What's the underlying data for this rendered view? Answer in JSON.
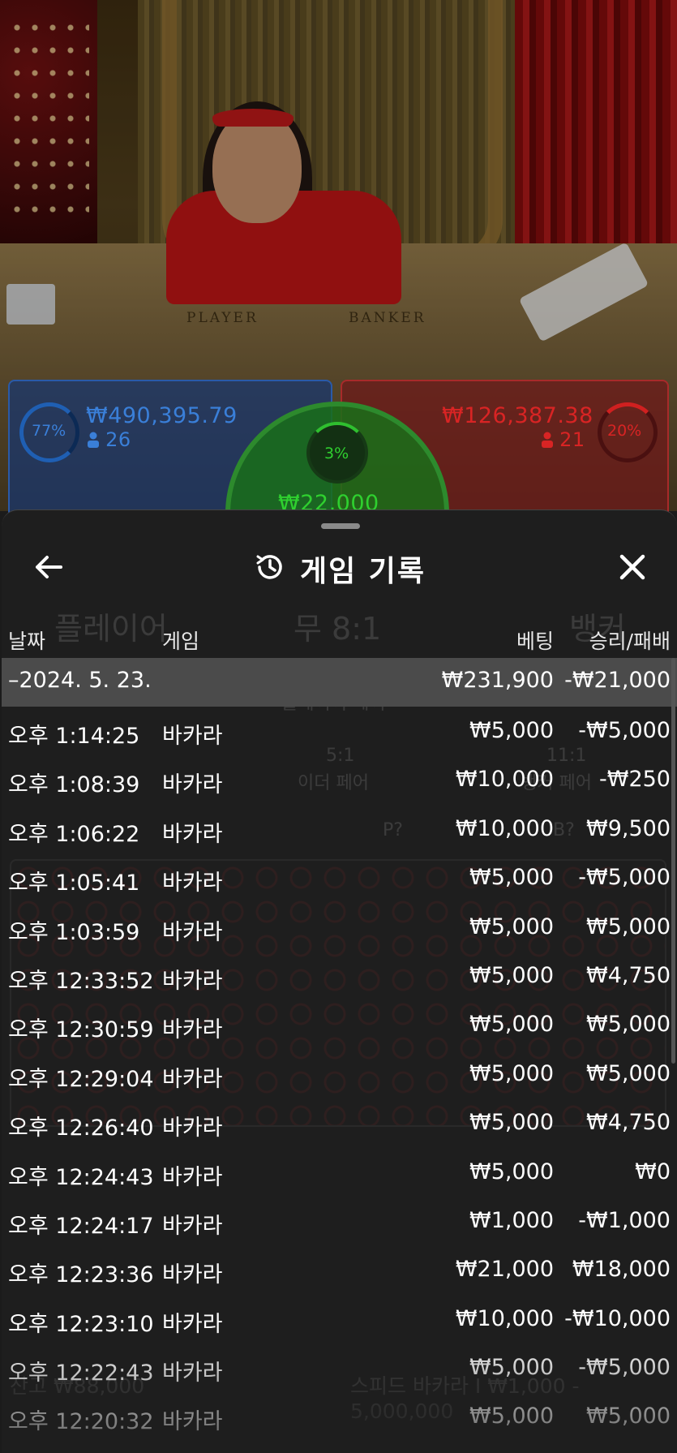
{
  "live_table": {
    "table_labels": {
      "player": "PLAYER",
      "banker": "BANKER"
    },
    "player": {
      "percent": "77%",
      "amount": "₩490,395.79",
      "players": "26",
      "color": "#3a7fd8"
    },
    "banker": {
      "percent": "20%",
      "amount": "₩126,387.38",
      "players": "21",
      "color": "#d82424"
    },
    "tie": {
      "percent": "3%",
      "amount": "₩22,000",
      "color": "#2fd02f"
    }
  },
  "sheet": {
    "title": "게임 기록",
    "icons": {
      "back": "arrow-left-icon",
      "history": "history-clock-icon",
      "close": "close-icon"
    },
    "columns": {
      "date": "날짜",
      "game": "게임",
      "bet": "베팅",
      "result": "승리/패배"
    },
    "date_group": {
      "date": "–2024. 5. 23.",
      "bet_total": "₩231,900",
      "result_total": "-₩21,000"
    },
    "rows": [
      {
        "time": "오후 1:14:25",
        "game": "바카라",
        "bet": "₩5,000",
        "result": "-₩5,000"
      },
      {
        "time": "오후 1:08:39",
        "game": "바카라",
        "bet": "₩10,000",
        "result": "-₩250"
      },
      {
        "time": "오후 1:06:22",
        "game": "바카라",
        "bet": "₩10,000",
        "result": "₩9,500"
      },
      {
        "time": "오후 1:05:41",
        "game": "바카라",
        "bet": "₩5,000",
        "result": "-₩5,000"
      },
      {
        "time": "오후 1:03:59",
        "game": "바카라",
        "bet": "₩5,000",
        "result": "₩5,000"
      },
      {
        "time": "오후 12:33:52",
        "game": "바카라",
        "bet": "₩5,000",
        "result": "₩4,750"
      },
      {
        "time": "오후 12:30:59",
        "game": "바카라",
        "bet": "₩5,000",
        "result": "₩5,000"
      },
      {
        "time": "오후 12:29:04",
        "game": "바카라",
        "bet": "₩5,000",
        "result": "₩5,000"
      },
      {
        "time": "오후 12:26:40",
        "game": "바카라",
        "bet": "₩5,000",
        "result": "₩4,750"
      },
      {
        "time": "오후 12:24:43",
        "game": "바카라",
        "bet": "₩5,000",
        "result": "₩0"
      },
      {
        "time": "오후 12:24:17",
        "game": "바카라",
        "bet": "₩1,000",
        "result": "-₩1,000"
      },
      {
        "time": "오후 12:23:36",
        "game": "바카라",
        "bet": "₩21,000",
        "result": "₩18,000"
      },
      {
        "time": "오후 12:23:10",
        "game": "바카라",
        "bet": "₩10,000",
        "result": "-₩10,000"
      },
      {
        "time": "오후 12:22:43",
        "game": "바카라",
        "bet": "₩5,000",
        "result": "-₩5,000"
      },
      {
        "time": "오후 12:20:32",
        "game": "바카라",
        "bet": "₩5,000",
        "result": "₩5,000"
      }
    ]
  },
  "background_game": {
    "bet_labels": [
      "플레이어",
      "무 8:1",
      "뱅커",
      "11:1",
      "플레이어 페어",
      "5:1",
      "이더 페어",
      "11:1",
      "뱅커 페어",
      "P?",
      "B?"
    ],
    "footer_balance": "잔고 ₩88,000",
    "footer_table": "스피드 바카라 I ₩1,000 - 5,000,000"
  }
}
